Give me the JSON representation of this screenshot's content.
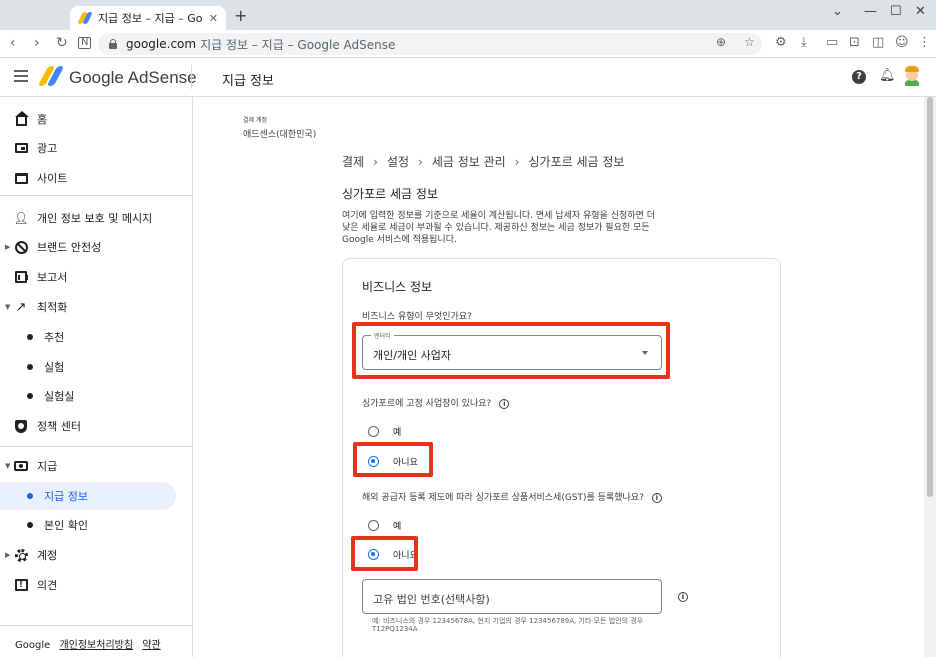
{
  "browser": {
    "tab_title": "지급 정보 – 지급 – Google AdSe",
    "url_host": "google.com",
    "url_rest": "지급 정보 – 지급 – Google AdSense"
  },
  "header": {
    "brand": "Google AdSense",
    "page_title": "지급 정보"
  },
  "sidebar": {
    "items": [
      {
        "label": "홈",
        "icon": "home-icon"
      },
      {
        "label": "광고",
        "icon": "ads-icon"
      },
      {
        "label": "사이트",
        "icon": "sites-icon"
      },
      {
        "label": "개인 정보 보호 및 메시지",
        "icon": "privacy-icon"
      },
      {
        "label": "브랜드 안전성",
        "icon": "block-icon"
      },
      {
        "label": "보고서",
        "icon": "reports-icon"
      },
      {
        "label": "최적화",
        "icon": "trending-icon"
      },
      {
        "label": "추천"
      },
      {
        "label": "실험"
      },
      {
        "label": "실험실"
      },
      {
        "label": "정책 센터",
        "icon": "shield-icon"
      },
      {
        "label": "지급",
        "icon": "payments-icon"
      },
      {
        "label": "지급 정보"
      },
      {
        "label": "본인 확인"
      },
      {
        "label": "계정",
        "icon": "gear-icon"
      },
      {
        "label": "의견",
        "icon": "feedback-icon"
      }
    ],
    "footer": {
      "google": "Google",
      "privacy": "개인정보처리방침",
      "terms": "약관"
    }
  },
  "account": {
    "label": "결제 계정",
    "name": "애드센스(대한민국)"
  },
  "breadcrumb": [
    "결제",
    "설정",
    "세금 정보 관리",
    "싱가포르 세금 정보"
  ],
  "page": {
    "title": "싱가포르 세금 정보",
    "intro": "여기에 입력한 정보를 기준으로 세율이 계산됩니다. 면세 납세자 유형을 신청하면 더 낮은 세율로 세금이 부과될 수 있습니다. 제공하신 정보는 세금 정보가 필요한 모든 Google 서비스에 적용됩니다."
  },
  "form": {
    "section_title": "비즈니스 정보",
    "q1": "비즈니스 유형이 무엇인가요?",
    "entity_label": "엔터티",
    "entity_value": "개인/개인 사업자",
    "q2": "싱가포르에 고정 사업장이 있나요?",
    "q2_yes": "예",
    "q2_no": "아니요",
    "q3": "해외 공급자 등록 제도에 따라 싱가포르 상품서비스세(GST)를 등록했나요?",
    "q3_yes": "예",
    "q3_no": "아니요",
    "uen_placeholder": "고유 법인 번호(선택사항)",
    "uen_hint": "예: 비즈니스의 경우 12345678A, 현지 기업의 경우 123456789A, 기타 모든 법인의 경우 T12PQ1234A"
  },
  "colors": {
    "highlight": "#e8321e",
    "accent": "#1a73e8"
  }
}
